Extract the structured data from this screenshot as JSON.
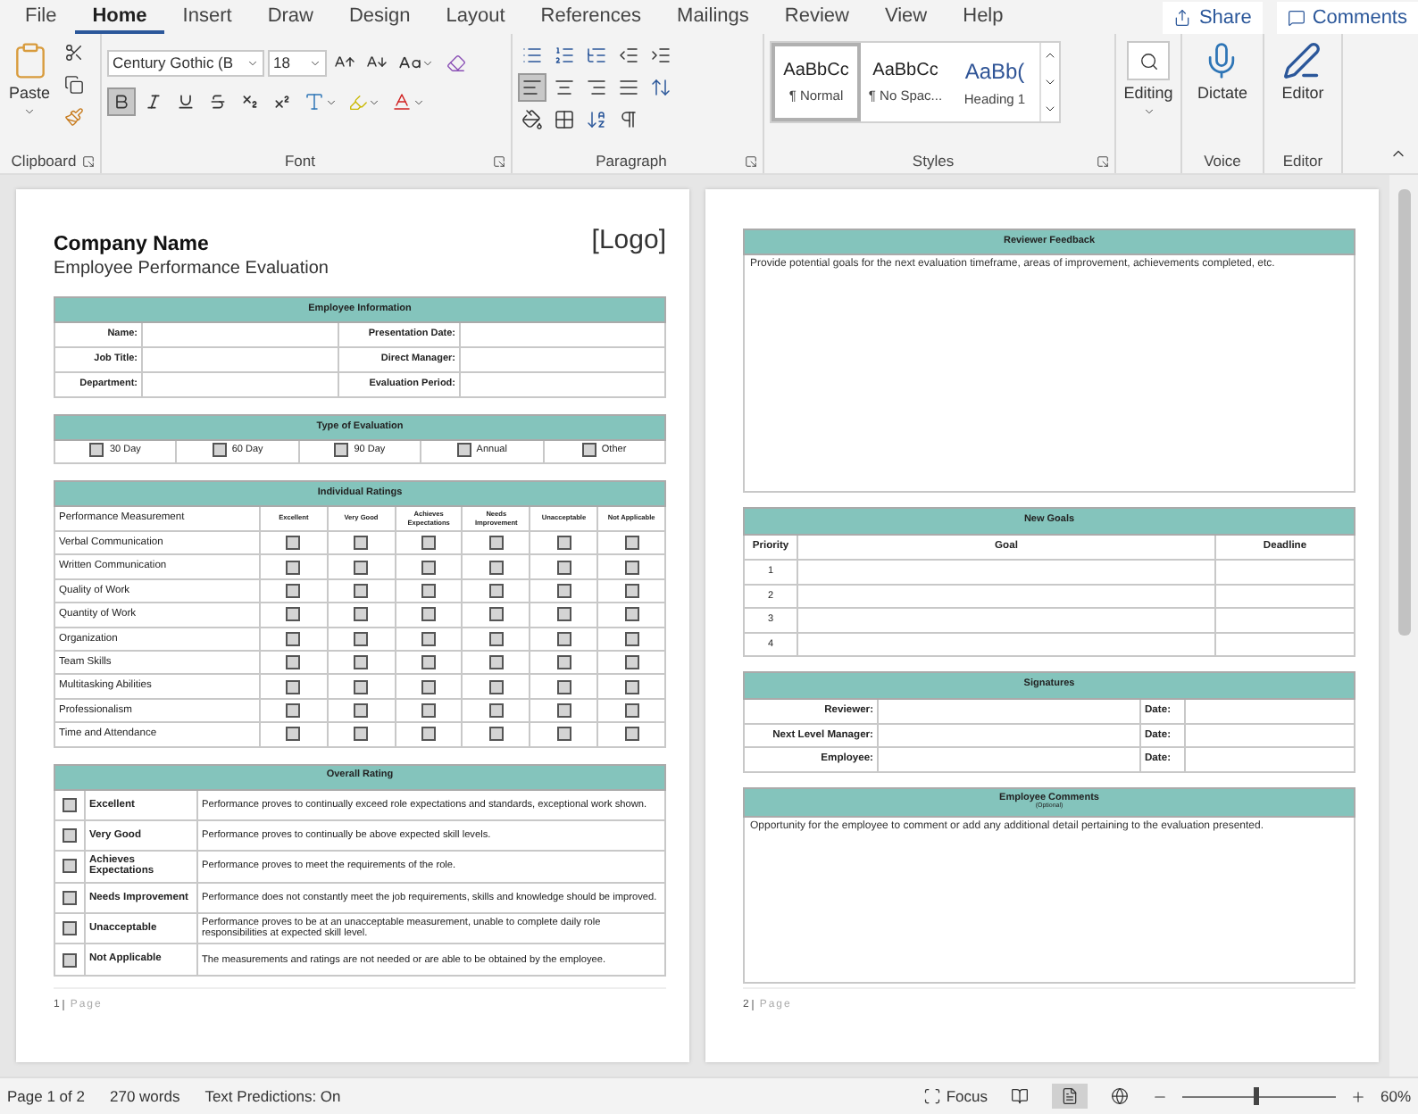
{
  "menu_tabs": [
    {
      "label": "File",
      "selected": false
    },
    {
      "label": "Home",
      "selected": true
    },
    {
      "label": "Insert",
      "selected": false
    },
    {
      "label": "Draw",
      "selected": false
    },
    {
      "label": "Design",
      "selected": false
    },
    {
      "label": "Layout",
      "selected": false
    },
    {
      "label": "References",
      "selected": false
    },
    {
      "label": "Mailings",
      "selected": false
    },
    {
      "label": "Review",
      "selected": false
    },
    {
      "label": "View",
      "selected": false
    },
    {
      "label": "Help",
      "selected": false
    }
  ],
  "share_button": "Share",
  "comments_button": "Comments",
  "ribbon": {
    "clipboard": {
      "paste": "Paste",
      "label": "Clipboard"
    },
    "font": {
      "name": "Century Gothic (B",
      "size": "18",
      "label": "Font",
      "formats": [
        {
          "kind": "bold",
          "selected": true
        },
        {
          "kind": "italic",
          "selected": false
        },
        {
          "kind": "underline",
          "selected": false
        },
        {
          "kind": "strike",
          "selected": false
        },
        {
          "kind": "subscript",
          "selected": false
        },
        {
          "kind": "superscript",
          "selected": false
        }
      ]
    },
    "paragraph": {
      "label": "Paragraph",
      "alignments": [
        {
          "kind": "left",
          "selected": true
        },
        {
          "kind": "center",
          "selected": false
        },
        {
          "kind": "right",
          "selected": false
        },
        {
          "kind": "justify",
          "selected": false
        }
      ]
    },
    "styles": {
      "label": "Styles",
      "items": [
        {
          "kind": "body",
          "preview": "AaBbCc",
          "name": "¶ Normal",
          "selected": true
        },
        {
          "kind": "body",
          "preview": "AaBbCc",
          "name": "¶ No Spac...",
          "selected": false
        },
        {
          "kind": "heading",
          "preview": "AaBb(",
          "name": "Heading 1",
          "selected": false
        }
      ]
    },
    "editing": {
      "button": "Editing"
    },
    "voice": {
      "button": "Dictate",
      "label": "Voice"
    },
    "editor": {
      "button": "Editor",
      "label": "Editor"
    }
  },
  "page_1": {
    "company_name": "Company Name",
    "logo": "[Logo]",
    "subtitle": "Employee Performance Evaluation",
    "employee_information": {
      "title": "Employee Information",
      "rows": [
        {
          "label": "Name:",
          "label_2": "Presentation Date:"
        },
        {
          "label": "Job Title:",
          "label_2": "Direct Manager:"
        },
        {
          "label": "Department:",
          "label_2": "Evaluation Period:"
        }
      ]
    },
    "type_of_evaluation": {
      "title": "Type of Evaluation",
      "options": [
        {
          "label": "30 Day",
          "checked": false
        },
        {
          "label": "60 Day",
          "checked": false
        },
        {
          "label": "90 Day",
          "checked": false
        },
        {
          "label": "Annual",
          "checked": false
        },
        {
          "label": "Other",
          "checked": false
        }
      ]
    },
    "individual_ratings": {
      "title": "Individual Ratings",
      "first_column": "Performance Measurement",
      "columns": [
        "Excellent",
        "Very Good",
        "Achieves Expectations",
        "Needs Improvement",
        "Unacceptable",
        "Not Applicable"
      ],
      "rows": [
        {
          "label": "Verbal Communication",
          "checks": [
            false,
            false,
            false,
            false,
            false,
            false
          ]
        },
        {
          "label": "Written Communication",
          "checks": [
            false,
            false,
            false,
            false,
            false,
            false
          ]
        },
        {
          "label": "Quality of Work",
          "checks": [
            false,
            false,
            false,
            false,
            false,
            false
          ]
        },
        {
          "label": "Quantity of Work",
          "checks": [
            false,
            false,
            false,
            false,
            false,
            false
          ]
        },
        {
          "label": "Organization",
          "checks": [
            false,
            false,
            false,
            false,
            false,
            false
          ]
        },
        {
          "label": "Team Skills",
          "checks": [
            false,
            false,
            false,
            false,
            false,
            false
          ]
        },
        {
          "label": "Multitasking Abilities",
          "checks": [
            false,
            false,
            false,
            false,
            false,
            false
          ]
        },
        {
          "label": "Professionalism",
          "checks": [
            false,
            false,
            false,
            false,
            false,
            false
          ]
        },
        {
          "label": "Time and Attendance",
          "checks": [
            false,
            false,
            false,
            false,
            false,
            false
          ]
        }
      ]
    },
    "overall_rating": {
      "title": "Overall Rating",
      "rows": [
        {
          "label": "Excellent",
          "description": "Performance proves to continually exceed role expectations and standards, exceptional work shown.",
          "checked": false
        },
        {
          "label": "Very Good",
          "description": "Performance proves to continually be above expected skill levels.",
          "checked": false
        },
        {
          "label": "Achieves Expectations",
          "description": "Performance proves to meet the requirements of the role.",
          "checked": false
        },
        {
          "label": "Needs Improvement",
          "description": "Performance does not constantly meet the job requirements, skills and knowledge should be improved.",
          "checked": false
        },
        {
          "label": "Unacceptable",
          "description": "Performance proves to be at an unacceptable measurement, unable to complete daily role responsibilities at expected skill level.",
          "checked": false
        },
        {
          "label": "Not Applicable",
          "description": "The measurements and ratings are not needed or are able to be obtained by the employee.",
          "checked": false
        }
      ]
    },
    "footer": {
      "number": "1",
      "label": "Page"
    }
  },
  "page_2": {
    "reviewer_feedback": {
      "title": "Reviewer Feedback",
      "text": "Provide potential goals for the next evaluation timeframe, areas of improvement, achievements completed, etc."
    },
    "new_goals": {
      "title": "New Goals",
      "columns": [
        "Priority",
        "Goal",
        "Deadline"
      ],
      "rows": [
        "1",
        "2",
        "3",
        "4"
      ]
    },
    "signatures": {
      "title": "Signatures",
      "rows": [
        {
          "label": "Reviewer:",
          "date_label": "Date:"
        },
        {
          "label": "Next Level Manager:",
          "date_label": "Date:"
        },
        {
          "label": "Employee:",
          "date_label": "Date:"
        }
      ]
    },
    "employee_comments": {
      "title": "Employee Comments",
      "subtitle": "(Optional)",
      "text": "Opportunity for the employee to comment or add any additional detail pertaining to the evaluation presented."
    },
    "footer": {
      "number": "2",
      "label": "Page"
    }
  },
  "status_bar": {
    "page": "Page 1 of 2",
    "words": "270 words",
    "predictions": "Text Predictions: On",
    "focus": "Focus",
    "views": [
      {
        "kind": "read",
        "selected": false
      },
      {
        "kind": "print",
        "selected": true
      },
      {
        "kind": "web",
        "selected": false
      }
    ],
    "zoom": {
      "level": 0.48
    },
    "zoom_text": "60%"
  }
}
